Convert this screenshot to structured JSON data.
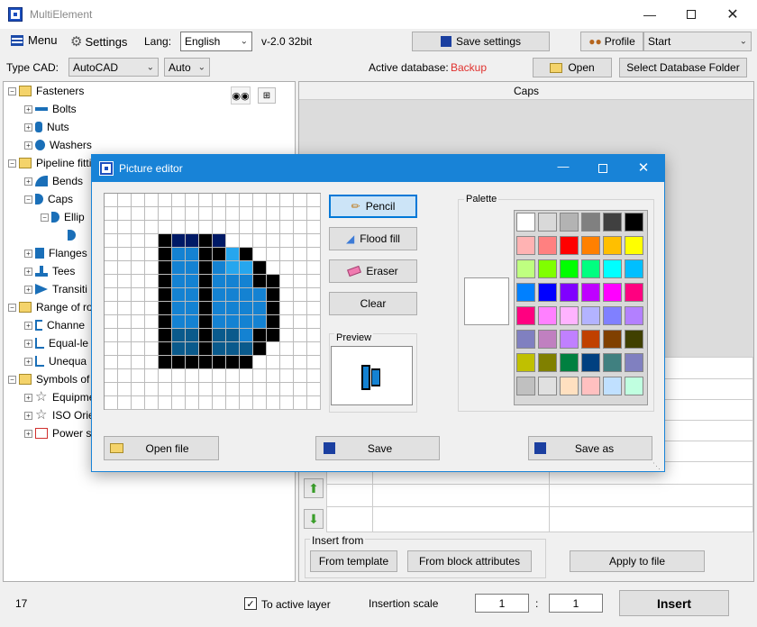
{
  "window": {
    "title": "MultiElement"
  },
  "toolbar": {
    "menu_label": "Menu",
    "settings_label": "Settings",
    "lang_label": "Lang:",
    "lang_value": "English",
    "version": "v-2.0 32bit",
    "save_settings_label": "Save settings",
    "profile_label": "Profile",
    "start_value": "Start"
  },
  "cadbar": {
    "type_cad_label": "Type CAD:",
    "cad_value": "AutoCAD",
    "mode_value": "Auto",
    "active_db_label": "Active database:",
    "active_db_value": "Backup",
    "open_label": "Open",
    "select_folder_label": "Select Database Folder"
  },
  "tree": {
    "items": [
      {
        "label": "Fasteners",
        "kind": "folder"
      },
      {
        "label": "Bolts",
        "kind": "bolt"
      },
      {
        "label": "Nuts",
        "kind": "nut"
      },
      {
        "label": "Washers",
        "kind": "washer"
      },
      {
        "label": "Pipeline fitti",
        "kind": "folder"
      },
      {
        "label": "Bends",
        "kind": "bend"
      },
      {
        "label": "Caps",
        "kind": "cap"
      },
      {
        "label": "Ellip",
        "kind": "cap"
      },
      {
        "label": "",
        "kind": "cap"
      },
      {
        "label": "Flanges",
        "kind": "flange"
      },
      {
        "label": "Tees",
        "kind": "tee"
      },
      {
        "label": "Transiti",
        "kind": "transition"
      },
      {
        "label": "Range of ro",
        "kind": "folder"
      },
      {
        "label": "Channe",
        "kind": "channel"
      },
      {
        "label": "Equal-le",
        "kind": "angle"
      },
      {
        "label": "Unequa",
        "kind": "angle"
      },
      {
        "label": "Symbols of",
        "kind": "folder"
      },
      {
        "label": "Equipme",
        "kind": "star"
      },
      {
        "label": "ISO Orie",
        "kind": "star"
      },
      {
        "label": "Power s",
        "kind": "power"
      }
    ]
  },
  "right_panel": {
    "header": "Caps",
    "insert_from_label": "Insert from",
    "from_template_label": "From template",
    "from_block_label": "From block attributes",
    "apply_to_file_label": "Apply to file"
  },
  "statusbar": {
    "count": "17",
    "to_active_layer_label": "To active layer",
    "to_active_layer_checked": true,
    "insertion_scale_label": "Insertion scale",
    "scale_a": "1",
    "scale_sep": ":",
    "scale_b": "1",
    "insert_label": "Insert"
  },
  "dialog": {
    "title": "Picture editor",
    "pencil_label": "Pencil",
    "flood_fill_label": "Flood fill",
    "eraser_label": "Eraser",
    "clear_label": "Clear",
    "preview_label": "Preview",
    "palette_label": "Palette",
    "open_file_label": "Open file",
    "save_label": "Save",
    "save_as_label": "Save as",
    "pixels": [
      "................",
      "................",
      "................",
      "....KNNKN.......",
      "....KBBKKLK.....",
      "....KBBKBLLK....",
      "....KBBKBBBKK...",
      "....KBBKBBBBK...",
      "....KBBKBBBBK...",
      "....KBBKBBBBK...",
      "....KCCKCCBKK...",
      "....KCCKCCCK....",
      "....KKKKKKK.....",
      "................",
      "................",
      "................"
    ],
    "pixel_colors": {
      "K": "#000000",
      "N": "#001a66",
      "B": "#1482d2",
      "L": "#26a6ee",
      "C": "#0a5a8c"
    },
    "palette_colors": [
      "#ffffff",
      "#d9d9d9",
      "#b3b3b3",
      "#808080",
      "#404040",
      "#000000",
      "#ffb3b3",
      "#ff8080",
      "#ff0000",
      "#ff8000",
      "#ffbf00",
      "#ffff00",
      "#bfff80",
      "#80ff00",
      "#00ff00",
      "#00ff80",
      "#00ffff",
      "#00bfff",
      "#0080ff",
      "#0000ff",
      "#8000ff",
      "#bf00ff",
      "#ff00ff",
      "#ff0080",
      "#ff0080",
      "#ff80ff",
      "#ffb3ff",
      "#b3b3ff",
      "#8080ff",
      "#b380ff",
      "#8080c0",
      "#c080c0",
      "#c080ff",
      "#c04000",
      "#804000",
      "#404000",
      "#c0c000",
      "#808000",
      "#008040",
      "#004080",
      "#408080",
      "#8080c0",
      "#c0c0c0",
      "#e0e0e0",
      "#ffe0c0",
      "#ffc0c0",
      "#c0e0ff",
      "#c0ffe0"
    ],
    "selected_color": "#ffffff"
  }
}
